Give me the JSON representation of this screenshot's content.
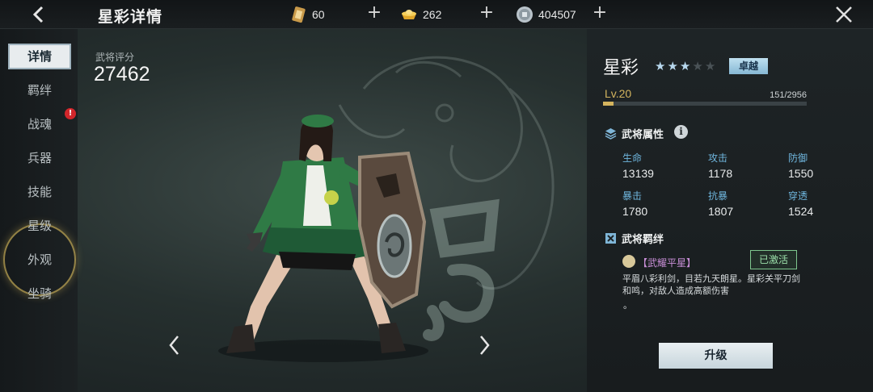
{
  "header": {
    "title": "星彩详情",
    "back_icon": "chevron-left-icon",
    "close_icon": "close-icon",
    "currencies": [
      {
        "icon": "token-card-icon",
        "amount": "60"
      },
      {
        "icon": "gold-ingot-icon",
        "amount": "262"
      },
      {
        "icon": "coin-icon",
        "amount": "404507"
      }
    ]
  },
  "nav": {
    "items": [
      {
        "label": "详情",
        "active": true
      },
      {
        "label": "羁绊"
      },
      {
        "label": "战魂",
        "badge": "!"
      },
      {
        "label": "兵器"
      },
      {
        "label": "技能"
      },
      {
        "label": "星级"
      },
      {
        "label": "外观"
      },
      {
        "label": "坐骑"
      }
    ]
  },
  "score": {
    "label": "武将评分",
    "value": "27462"
  },
  "hero": {
    "name": "星彩",
    "stars_total": 5,
    "stars_filled": 3,
    "rank": "卓越",
    "level": "Lv.20",
    "exp": "151/2956",
    "exp_fraction": 0.051
  },
  "attributes": {
    "title": "武将属性",
    "info": "i",
    "stats": [
      {
        "label": "生命",
        "value": "13139"
      },
      {
        "label": "攻击",
        "value": "1178"
      },
      {
        "label": "防御",
        "value": "1550"
      },
      {
        "label": "暴击",
        "value": "1780"
      },
      {
        "label": "抗暴",
        "value": "1807"
      },
      {
        "label": "穿透",
        "value": "1524"
      }
    ]
  },
  "bonds": {
    "title": "武将羁绊",
    "bond_name": "【武耀平星】",
    "status": "已激活",
    "desc": "平眉八彩利剑，目若九天朗星。星彩关平刀剑和鸣，对敌人造成高额伤害",
    "more": "。"
  },
  "actions": {
    "upgrade": "升级"
  },
  "colors": {
    "accent_gold": "#d4b45e",
    "stat_blue": "#6fb6de",
    "activated_green": "#9ce0aa",
    "bond_purple": "#c98fd8"
  }
}
